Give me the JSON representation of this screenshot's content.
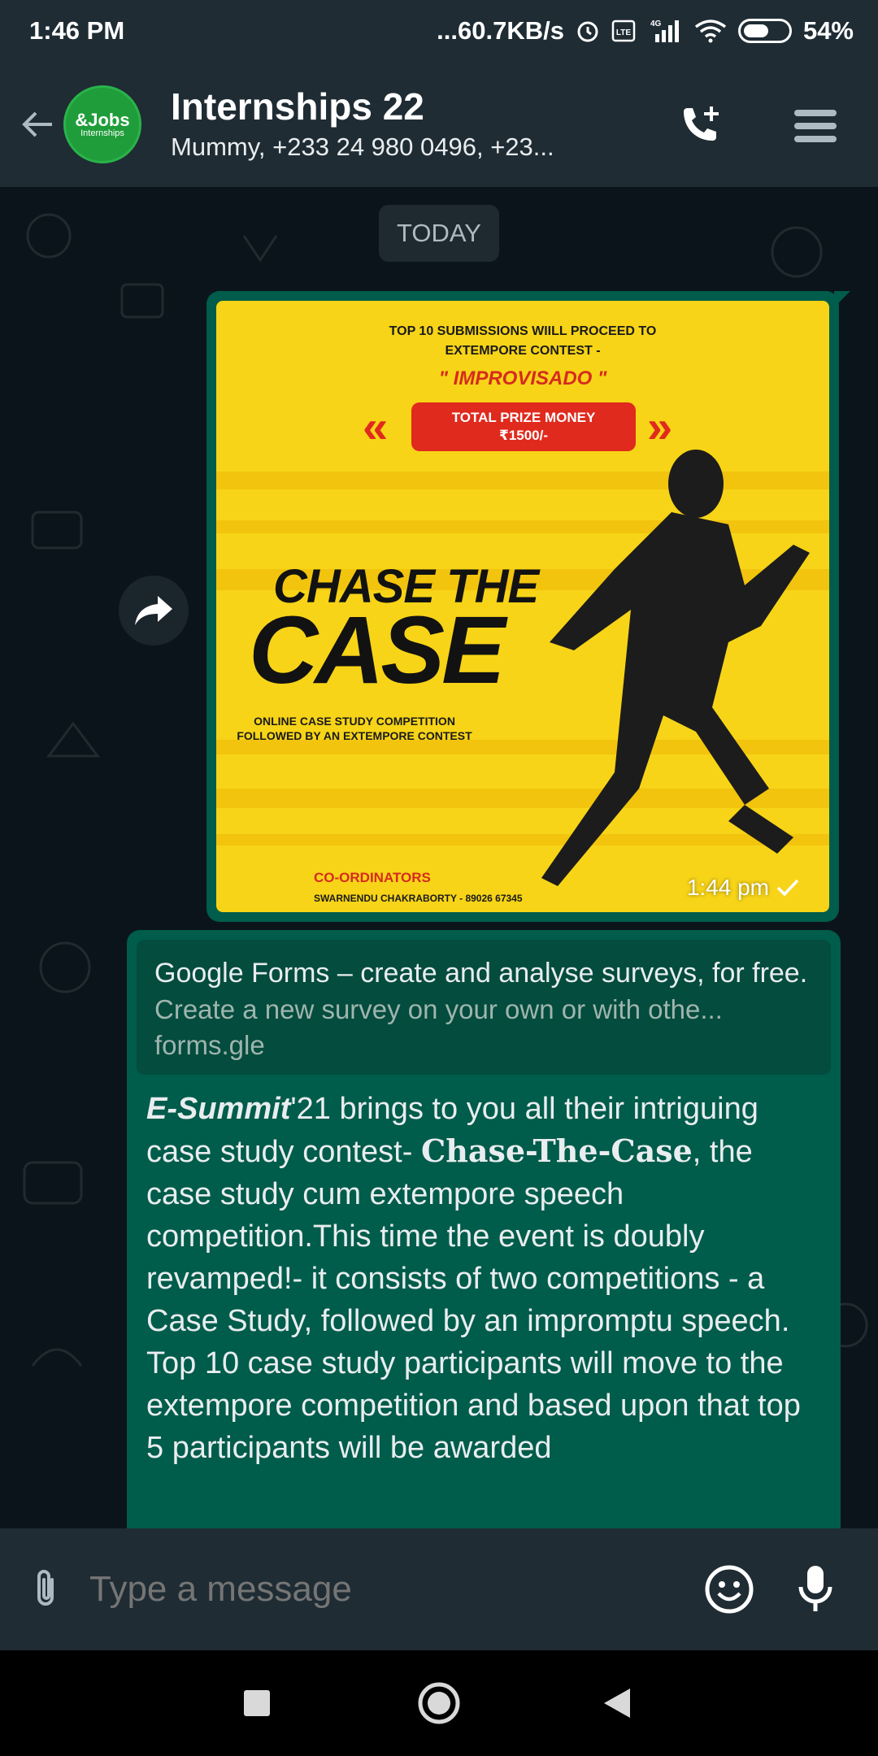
{
  "status_bar": {
    "time": "1:46 PM",
    "network_speed": "...60.7KB/s",
    "network_type": "4G",
    "battery": "54%",
    "icons": [
      "alarm-icon",
      "volte-icon",
      "signal-icon",
      "wifi-icon",
      "battery-icon"
    ]
  },
  "header": {
    "avatar_line1": "&Jobs",
    "avatar_line2": "Internships",
    "title": "Internships 22",
    "subtitle": "Mummy, +233 24 980 0496, +23...",
    "icons": [
      "back-arrow-icon",
      "add-call-icon",
      "menu-icon"
    ]
  },
  "chat": {
    "date_chip": "TODAY",
    "image_message": {
      "time": "1:44 pm",
      "status_icon": "check-icon",
      "poster": {
        "top_line1": "TOP 10 SUBMISSIONS WIILL PROCEED TO",
        "top_line2": "EXTEMPORE CONTEST -",
        "improvisado": "\" IMPROVISADO \"",
        "prize_line1": "TOTAL PRIZE MONEY",
        "prize_line2": "₹1500/-",
        "title_line1": "CHASE THE",
        "title_line2": "CASE",
        "sub_line1": "ONLINE CASE STUDY COMPETITION",
        "sub_line2": "FOLLOWED BY AN EXTEMPORE CONTEST",
        "coordinators": "CO-ORDINATORS",
        "person": "SWARNENDU CHAKRABORTY - 89026 67345"
      }
    },
    "text_message": {
      "link_title": "Google Forms – create and analyse surveys, for free.",
      "link_description": "Create a new survey on your own or with othe...",
      "link_domain": "forms.gle",
      "body_bold_italic": "E-Summit",
      "body_part1": "'21 brings to you all their intriguing case study contest-",
      "body_serif_bold": "Chase-The-Case",
      "body_part2": ", the case study cum extempore speech competition.This time the event is doubly revamped!- it consists of two competitions -  a Case Study, followed by an impromptu speech. Top 10 case study participants will move to the extempore competition and based upon that top 5 participants will be awarded"
    }
  },
  "input_bar": {
    "placeholder": "Type a message",
    "icons": [
      "attach-icon",
      "emoji-icon",
      "mic-icon"
    ]
  },
  "nav_bar": {
    "icons": [
      "recents-icon",
      "home-icon",
      "back-icon"
    ]
  }
}
